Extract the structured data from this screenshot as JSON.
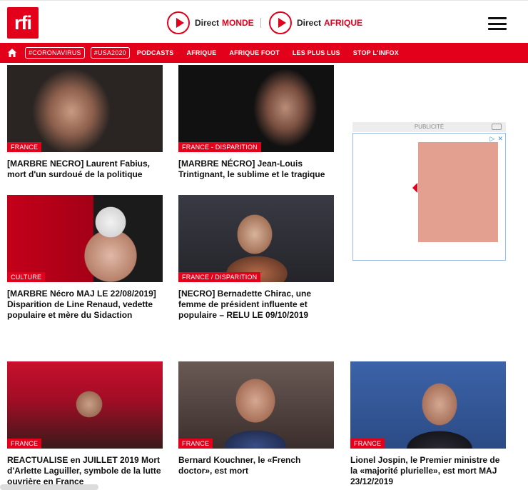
{
  "header": {
    "logo_text": "rfi",
    "direct_monde": {
      "prefix": "Direct",
      "accent": "MONDE"
    },
    "direct_afrique": {
      "prefix": "Direct",
      "accent": "AFRIQUE"
    },
    "brand_color": "#e2001a"
  },
  "nav": {
    "pills": [
      "#CORONAVIRUS",
      "#USA2020"
    ],
    "links": [
      "PODCASTS",
      "AFRIQUE",
      "AFRIQUE FOOT",
      "LES PLUS LUS",
      "STOP L'INFOX"
    ]
  },
  "articles": [
    {
      "tag": "FRANCE",
      "title": "[MARBRE NECRO] Laurent Fabius, mort d'un surdoué de la politique"
    },
    {
      "tag": "FRANCE - DISPARITION",
      "title": "[MARBRE NÉCRO] Jean-Louis Trintignant, le sublime et le tragique"
    },
    {
      "tag": "CULTURE",
      "title": "[MARBRE Nécro MAJ LE 22/08/2019] Disparition de Line Renaud, vedette populaire et mère du Sidaction"
    },
    {
      "tag": "FRANCE / DISPARITION",
      "title": "[NECRO] Bernadette Chirac, une femme de président influente et populaire – RELU LE 09/10/2019"
    },
    {
      "tag": "FRANCE",
      "title": "REACTUALISE en JUILLET 2019 Mort d'Arlette Laguiller, symbole de la lutte ouvrière en France"
    },
    {
      "tag": "FRANCE",
      "title": "Bernard Kouchner, le «French doctor», est mort"
    },
    {
      "tag": "FRANCE",
      "title": "Lionel Jospin, le Premier ministre de la «majorité plurielle», est mort MAJ 23/12/2019"
    }
  ],
  "ad": {
    "label": "PUBLICITÉ",
    "ad_block_color": "#e3a091"
  }
}
